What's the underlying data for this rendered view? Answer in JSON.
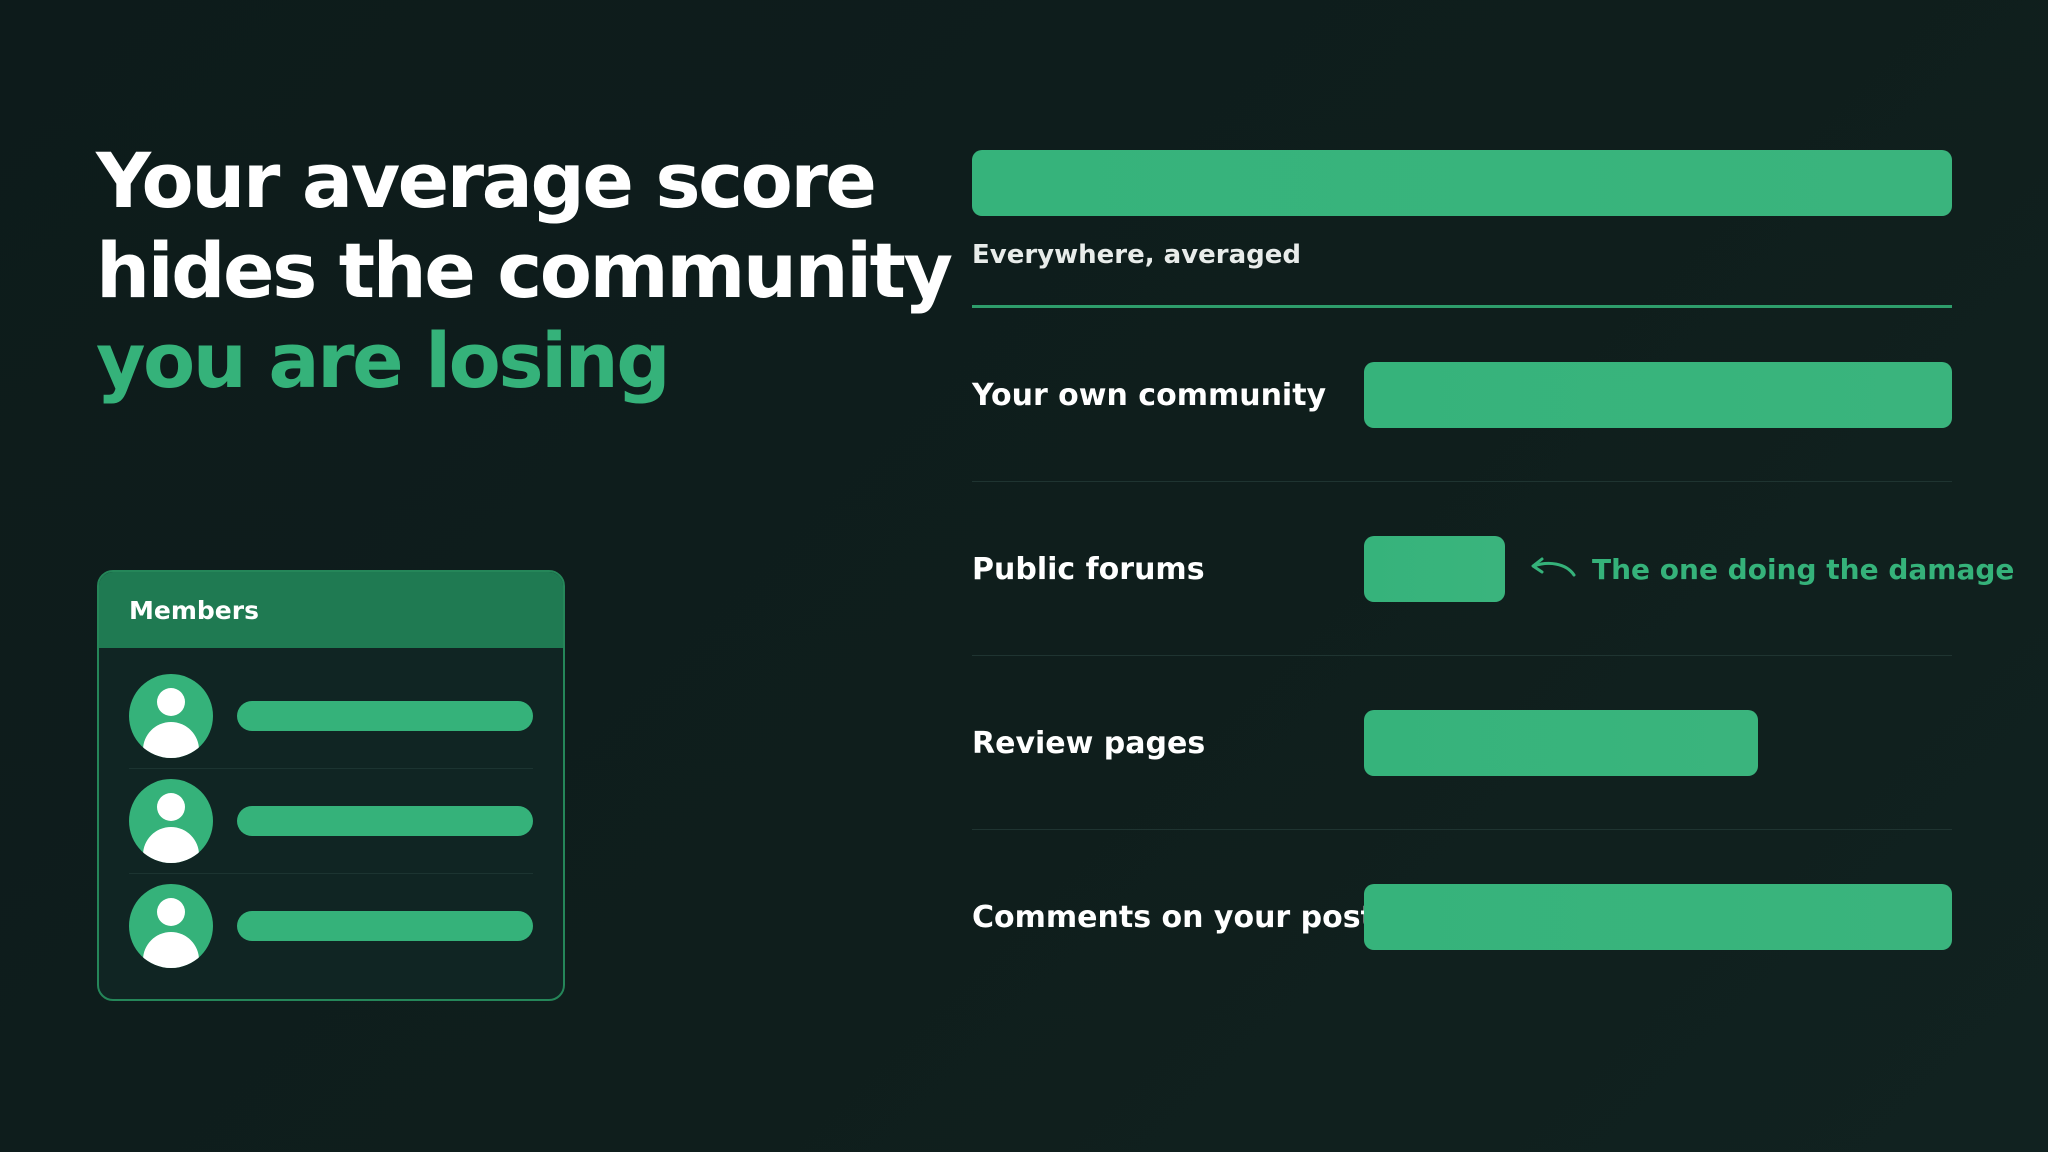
{
  "headline": {
    "line1": "Your average score",
    "line2": "hides the community",
    "line3": "you are losing"
  },
  "members_card": {
    "title": "Members",
    "rows": [
      {
        "avatar_icon": "user-avatar-icon"
      },
      {
        "avatar_icon": "user-avatar-icon"
      },
      {
        "avatar_icon": "user-avatar-icon"
      }
    ]
  },
  "chart_data": {
    "type": "bar",
    "overall": {
      "label": "Everywhere, averaged",
      "value": 1.0
    },
    "categories": [
      "Your own community",
      "Public forums",
      "Review pages",
      "Comments on your posts"
    ],
    "values": [
      1.0,
      0.24,
      0.67,
      1.0
    ],
    "annotation": {
      "category": "Public forums",
      "text": "The one doing the damage",
      "icon": "curved-arrow-left-icon"
    },
    "colors": {
      "bar": "#36b37b",
      "accent": "#35b27a",
      "background": "#0f1e1c"
    }
  }
}
